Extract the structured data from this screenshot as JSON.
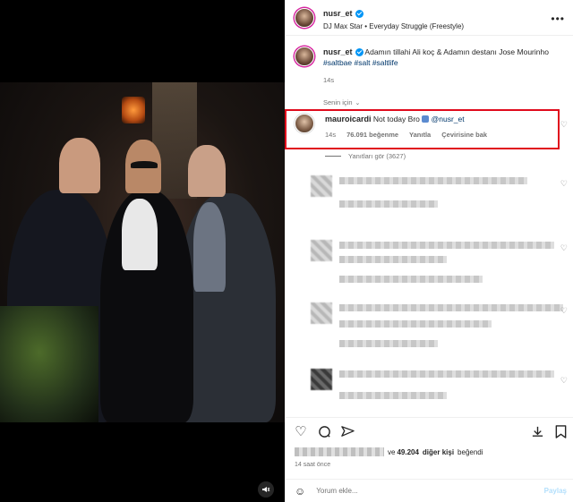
{
  "post": {
    "username": "nusr_et",
    "subtitle": "DJ Max Star • Everyday Struggle (Freestyle)",
    "more": "•••"
  },
  "caption": {
    "username": "nusr_et",
    "text": "Adamın tillahi Ali koç & Adamın destanı Jose Mourinho",
    "hashtags": "#saltbae #salt #saltlife",
    "time": "14s"
  },
  "filter": {
    "label": "Senin için",
    "chevron": "⌄"
  },
  "highlighted_comment": {
    "username": "mauroicardi",
    "text": "Not today Bro",
    "mention": "@nusr_et",
    "time": "14s",
    "likes": "76.091 beğenme",
    "reply": "Yanıtla",
    "translate": "Çevirisine bak",
    "view_replies": "Yanıtları gör (3627)"
  },
  "likes": {
    "connector": "ve",
    "count": "49.204",
    "suffix": "diğer kişi",
    "verb": "beğendi"
  },
  "time_ago": "14 saat önce",
  "composer": {
    "placeholder": "Yorum ekle...",
    "post": "Paylaş"
  },
  "colors": {
    "highlight": "#e00b1c",
    "link": "#00376b",
    "verified": "#0095f6"
  }
}
